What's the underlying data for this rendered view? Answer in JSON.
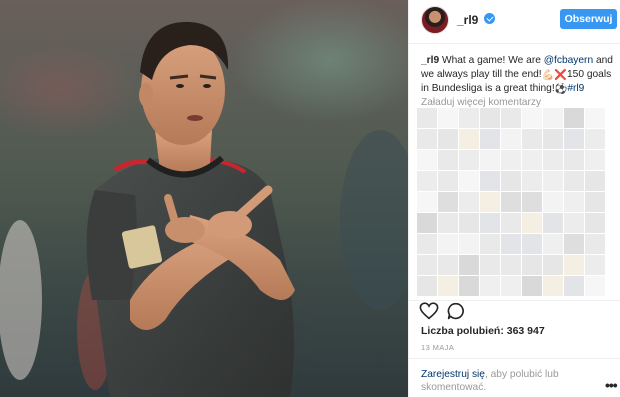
{
  "post": {
    "username": "_rl9",
    "follow_label": "Obserwuj",
    "caption": {
      "user": "_rl9",
      "text_1": " What a game! We are ",
      "mention": "@fcbayern",
      "text_2": " and we always play till the end!",
      "emoji_1": "💪🏻",
      "emoji_2": "❌",
      "text_3": "150 goals in Bundesliga is a great thing!",
      "emoji_3": "⚽",
      "hashtag": "#rl9"
    },
    "load_more_label": "Załaduj więcej komentarzy",
    "likes_label": "Liczba polubień: 363 947",
    "date": "13 MAJA",
    "footer": {
      "register_link": "Zarejestruj się",
      "rest_text": ", aby polubić lub skomentować."
    }
  },
  "colors": {
    "accent": "#3897f0",
    "link": "#003569",
    "muted": "#999999",
    "kit": "#3a3d3c",
    "kit_trim": "#c8262e"
  },
  "icons": {
    "verified": "verified-badge-icon",
    "like": "heart-icon",
    "comment": "comment-bubble-icon",
    "more": "more-options-icon"
  }
}
